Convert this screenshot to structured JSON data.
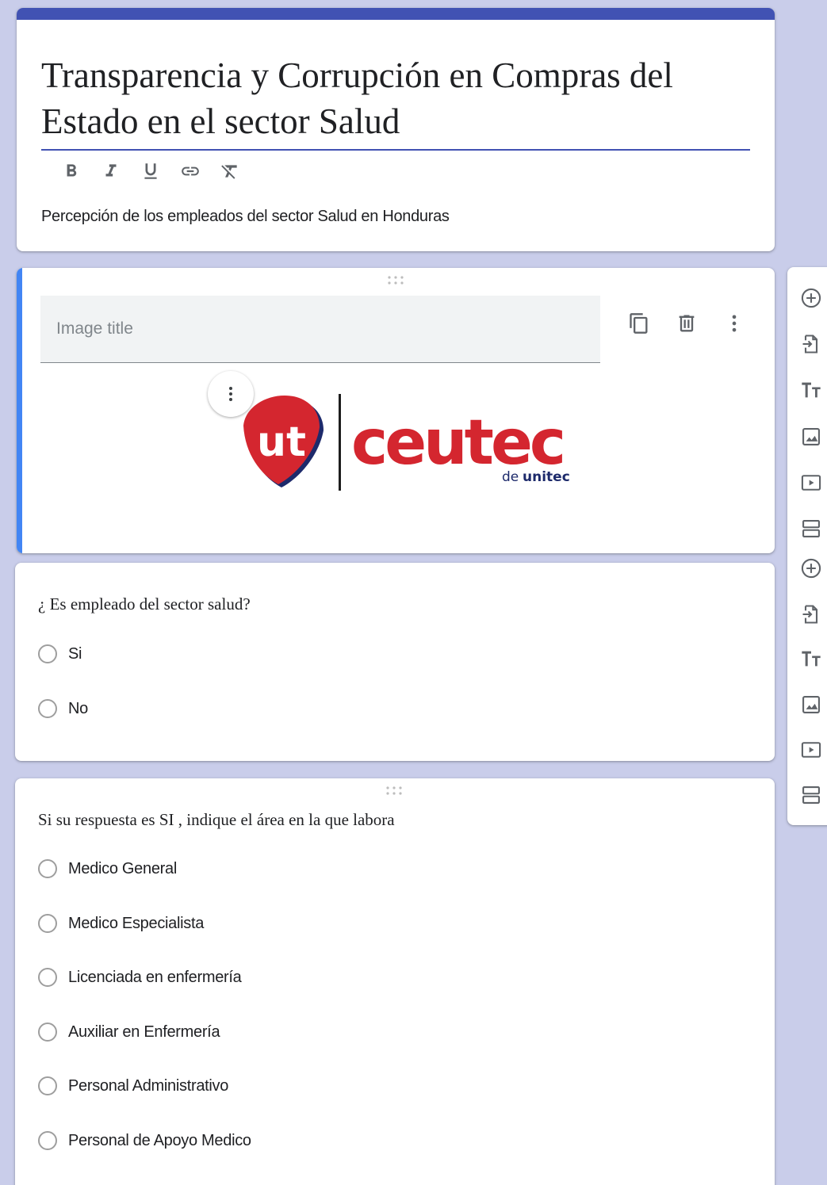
{
  "form": {
    "title": "Transparencia y Corrupción en Compras del Estado en el sector Salud",
    "description": "Percepción de los empleados del sector Salud en Honduras",
    "format_toolbar": [
      "bold-icon",
      "italic-icon",
      "underline-icon",
      "link-icon",
      "clear-format-icon"
    ]
  },
  "image_item": {
    "title_placeholder": "Image title",
    "actions": [
      "duplicate-icon",
      "delete-icon",
      "more-vert-icon"
    ],
    "logo": {
      "mark": "ut",
      "wordmark": "ceutec",
      "tagline_prefix": "de",
      "tagline_brand": "unitec"
    }
  },
  "question1": {
    "title": "¿ Es empleado del sector salud?",
    "options": [
      "Si",
      "No"
    ]
  },
  "question2": {
    "title": "Si su respuesta es SI , indique el área en la que labora",
    "options": [
      "Medico General",
      "Medico Especialista",
      "Licenciada en enfermería",
      "Auxiliar en Enfermería",
      "Personal Administrativo",
      "Personal de Apoyo Medico"
    ]
  },
  "side_toolbar": {
    "tools": [
      "add-question-icon",
      "import-questions-icon",
      "add-title-icon",
      "add-image-icon",
      "add-video-icon",
      "add-section-icon",
      "add-question-icon",
      "import-questions-icon",
      "add-title-icon",
      "add-image-icon",
      "add-video-icon",
      "add-section-icon"
    ]
  },
  "colors": {
    "background": "#c9cdea",
    "theme": "#4152b3",
    "active_accent": "#4285f4",
    "logo_red": "#d4262f",
    "logo_navy": "#1d2a6b"
  }
}
